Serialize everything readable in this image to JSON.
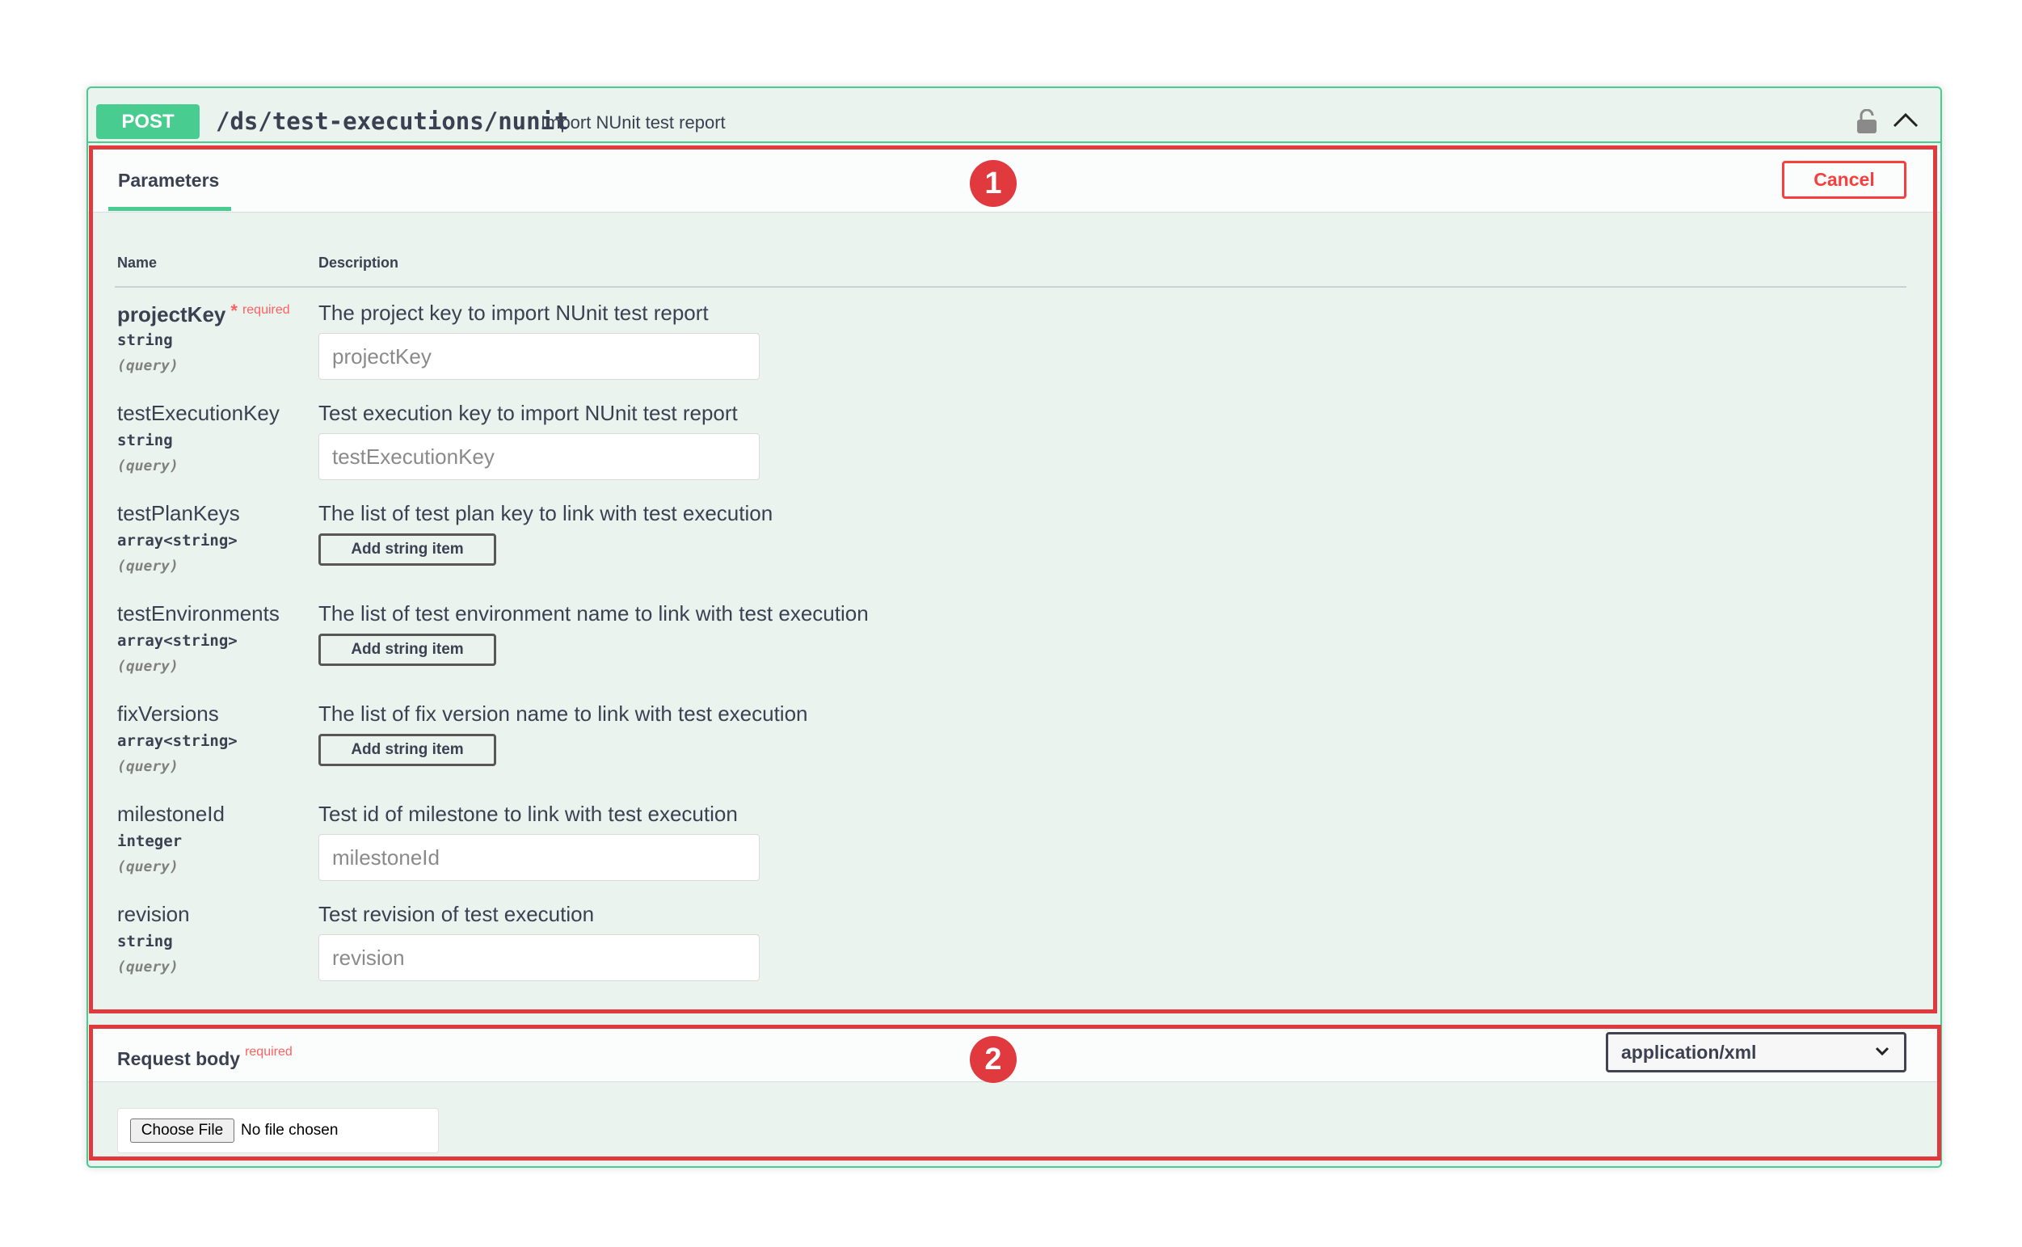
{
  "operation": {
    "method": "POST",
    "path": "/ds/test-executions/nunit",
    "summary": "Import NUnit test report"
  },
  "parameters": {
    "tab_label": "Parameters",
    "cancel_label": "Cancel",
    "col_name": "Name",
    "col_description": "Description",
    "required_label": "required",
    "items": [
      {
        "name": "projectKey",
        "required": true,
        "type": "string",
        "in": "(query)",
        "description": "The project key to import NUnit test report",
        "control": "input",
        "placeholder": "projectKey",
        "value": ""
      },
      {
        "name": "testExecutionKey",
        "required": false,
        "type": "string",
        "in": "(query)",
        "description": "Test execution key to import NUnit test report",
        "control": "input",
        "placeholder": "testExecutionKey",
        "value": ""
      },
      {
        "name": "testPlanKeys",
        "required": false,
        "type": "array<string>",
        "in": "(query)",
        "description": "The list of test plan key to link with test execution",
        "control": "button",
        "button_label": "Add string item"
      },
      {
        "name": "testEnvironments",
        "required": false,
        "type": "array<string>",
        "in": "(query)",
        "description": "The list of test environment name to link with test execution",
        "control": "button",
        "button_label": "Add string item"
      },
      {
        "name": "fixVersions",
        "required": false,
        "type": "array<string>",
        "in": "(query)",
        "description": "The list of fix version name to link with test execution",
        "control": "button",
        "button_label": "Add string item"
      },
      {
        "name": "milestoneId",
        "required": false,
        "type": "integer",
        "in": "(query)",
        "description": "Test id of milestone to link with test execution",
        "control": "input",
        "placeholder": "milestoneId",
        "value": ""
      },
      {
        "name": "revision",
        "required": false,
        "type": "string",
        "in": "(query)",
        "description": "Test revision of test execution",
        "control": "input",
        "placeholder": "revision",
        "value": ""
      }
    ]
  },
  "request_body": {
    "title": "Request body",
    "required_label": "required",
    "content_type": "application/xml",
    "file_button_label": "Choose File",
    "file_status": "No file chosen"
  },
  "annotations": [
    {
      "label": "1"
    },
    {
      "label": "2"
    }
  ],
  "colors": {
    "post_green": "#49cc90",
    "cancel_red": "#f93e3e",
    "annotation_red": "#e0393e",
    "panel_bg": "#ebf3ef",
    "text": "#3b4151"
  },
  "icons": {
    "lock": "lock-icon",
    "collapse": "chevron-up-icon",
    "select": "chevron-down-icon"
  }
}
